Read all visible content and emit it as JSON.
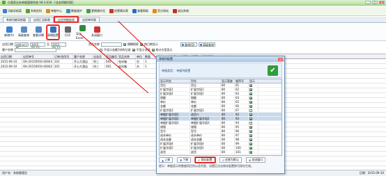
{
  "window": {
    "title": "亿管家业务单据管理系统 V8.3.618 - [业务明细列表]",
    "buttons": [
      "_",
      "□",
      "×"
    ]
  },
  "top_toolbar": [
    {
      "label": "功能导航菜",
      "icon": "home-icon",
      "color": "#3b7dd8"
    },
    {
      "label": "系统定码",
      "icon": "gear-icon",
      "color": "#5a9e3a"
    },
    {
      "label": "单据中心",
      "icon": "doc-icon",
      "color": "#d88a2b"
    },
    {
      "label": "数据维护",
      "icon": "db-icon",
      "color": "#3f8fb8"
    },
    {
      "label": "更换操作员",
      "icon": "user-icon",
      "color": "#4a9d4a"
    },
    {
      "label": "经营情况表",
      "icon": "chart-icon",
      "color": "#c33"
    },
    {
      "label": "查看帮助",
      "icon": "help-icon",
      "color": "#2f6cc0"
    },
    {
      "label": "官方网站",
      "icon": "web-icon",
      "color": "#e08a1e"
    },
    {
      "label": "退出系统",
      "icon": "exit-icon",
      "color": "#c03030"
    }
  ],
  "tabs": [
    {
      "label": "系统功能导航窗",
      "active": false
    },
    {
      "label": "出货汇总报表",
      "active": false
    },
    {
      "label": "出货明细报表",
      "active": true
    },
    {
      "label": "出货单列表",
      "active": false
    }
  ],
  "action_toolbar": [
    {
      "label": "新增(A)",
      "icon": "new-icon",
      "color": "#3b7fd6",
      "selected": false
    },
    {
      "label": "高级查询",
      "icon": "search-icon",
      "color": "#5a8dc4",
      "selected": false
    },
    {
      "label": "查看详情",
      "icon": "detail-icon",
      "color": "#4e89c8",
      "selected": false
    },
    {
      "label": "表格配置",
      "icon": "table-config-icon",
      "color": "#3a6fb8",
      "selected": true
    },
    {
      "label": "打印",
      "icon": "print-icon",
      "color": "#666",
      "selected": false
    },
    {
      "label": "导出Excel",
      "icon": "excel-icon",
      "color": "#2e8b3d",
      "selected": false
    },
    {
      "label": "关闭窗口",
      "icon": "close-icon",
      "color": "#c33",
      "selected": false
    }
  ],
  "filters": {
    "date_label": "出货日期",
    "date_mode": "自定义日期",
    "date_from": "2015-09-10",
    "date_to": "2015-09-10",
    "product_label": "货品名称",
    "query_btn": "查询(Q)",
    "adv_query_btn": "高级查询",
    "customer_label": "客户名称",
    "opt_hide_zero": "不显示金额为0的记录",
    "opt_fuzzy": "模糊搜索",
    "opt_group": "按日期显示",
    "opt_detail": "不显示详细",
    "opt_all": "统计方案显示"
  },
  "grid": {
    "columns": [
      "出货日期",
      "出货单号",
      "订单/合同号",
      "客户名称",
      "业务员",
      "货品编号",
      "货品名称",
      "单位",
      "数量",
      "单价",
      "金额",
      "折扣",
      "税率",
      "货品规格"
    ],
    "rows": [
      [
        "2015-09-10",
        "OH-20150910-00043",
        "201",
        "开心大酒店",
        "徐三",
        "002",
        "电冰箱",
        "台",
        "1",
        "",
        "",
        "",
        "",
        ""
      ],
      [
        "2015-09-10",
        "OH-20150910-00042",
        "201",
        "开心大酒店",
        "徐三",
        "001",
        "电冰箱",
        "台",
        "1",
        "",
        "",
        "",
        "",
        ""
      ]
    ]
  },
  "dialog": {
    "title": "表格列配置",
    "subtitle": "单据类型：   单据列配置",
    "columns": [
      "显示列名",
      "列名",
      "显示宽度",
      "顺序号",
      "显示"
    ],
    "rows": [
      {
        "a": "货位",
        "b": "货位",
        "w": "80",
        "o": "61",
        "show": true,
        "hl": false
      },
      {
        "a": "扩展字段1",
        "b": "扩展字段1",
        "w": "80",
        "o": "62",
        "show": true,
        "hl": false
      },
      {
        "a": "扩展字段2",
        "b": "扩展字段2",
        "w": "80",
        "o": "63",
        "show": true,
        "hl": false
      },
      {
        "a": "税额",
        "b": "税额",
        "w": "80",
        "o": "64",
        "show": true,
        "hl": false
      },
      {
        "a": "单价",
        "b": "单价",
        "w": "80",
        "o": "65",
        "show": true,
        "hl": false
      },
      {
        "a": "金额",
        "b": "金额",
        "w": "80",
        "o": "66",
        "show": true,
        "hl": false
      },
      {
        "a": "扩展字段3",
        "b": "扩展字段3",
        "w": "80",
        "o": "67",
        "show": false,
        "hl": false
      },
      {
        "a": "单据扩展字段1",
        "b": "送货人",
        "w": "80",
        "o": "92",
        "show": true,
        "hl": true
      },
      {
        "a": "单据扩展字段2",
        "b": "单据扩展字段2",
        "w": "80",
        "o": "93",
        "show": true,
        "hl": true
      },
      {
        "a": "单据扩展字段3",
        "b": "单据扩展字段3",
        "w": "80",
        "o": "94",
        "show": false,
        "hl": false
      },
      {
        "a": "规格",
        "b": "规格",
        "w": "80",
        "o": "95",
        "show": true,
        "hl": false
      },
      {
        "a": "型号",
        "b": "型号",
        "w": "80",
        "o": "96",
        "show": true,
        "hl": false
      },
      {
        "a": "成本单价",
        "b": "成本单价",
        "w": "80",
        "o": "97",
        "show": true,
        "hl": false
      },
      {
        "a": "成本金额",
        "b": "成本金额",
        "w": "80",
        "o": "98",
        "show": true,
        "hl": false
      },
      {
        "a": "扩展字段4",
        "b": "扩展字段4",
        "w": "80",
        "o": "99",
        "show": true,
        "hl": false
      },
      {
        "a": "扩展字段5",
        "b": "扩展字段5",
        "w": "80",
        "o": "100",
        "show": true,
        "hl": false
      },
      {
        "a": "退货",
        "b": "退货",
        "w": "80",
        "o": "101",
        "show": true,
        "hl": false
      }
    ],
    "buttons": {
      "up": "上移",
      "down": "下移",
      "save": "保存配置",
      "restore": "还原为默认",
      "close": "关闭窗口"
    },
    "note": "提示：单据显示的数据项目列以及列宽、设置后点击保存配置即可保存生效。"
  },
  "status": {
    "left": "用户名：系统管理员",
    "right": "日期：2015-09-10"
  }
}
